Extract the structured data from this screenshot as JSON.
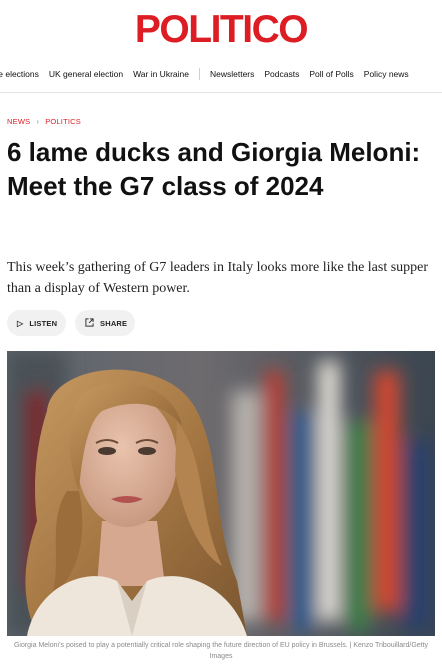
{
  "brand": {
    "logo_text": "POLITICO",
    "accent_color": "#dc1e24"
  },
  "nav": {
    "items": [
      "ce elections",
      "UK general election",
      "War in Ukraine",
      "Newsletters",
      "Podcasts",
      "Poll of Polls",
      "Policy news"
    ]
  },
  "breadcrumb": {
    "section": "NEWS",
    "subsection": "POLITICS"
  },
  "article": {
    "headline": "6 lame ducks and Giorgia Meloni: Meet the G7 class of 2024",
    "dek": "This week’s gathering of G7 leaders in Italy looks more like the last supper than a display of Western power.",
    "actions": {
      "listen_label": "LISTEN",
      "share_label": "SHARE"
    },
    "image": {
      "caption": "Giorgia Meloni’s poised to play a potentially critical role shaping the future direction of EU policy in Brussels. | Kenzo Tribouillard/Getty Images"
    }
  },
  "icons": {
    "listen": "play-icon",
    "share": "share-icon"
  }
}
